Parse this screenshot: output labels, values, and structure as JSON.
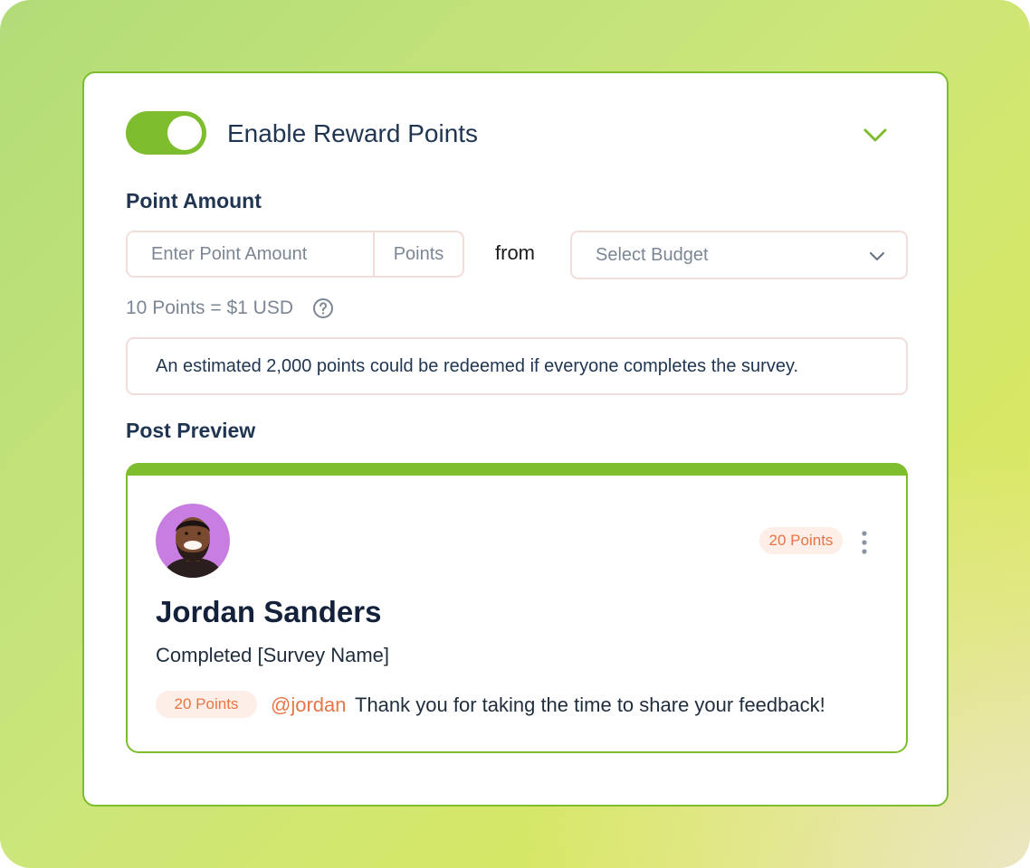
{
  "colors": {
    "accent": "#7dbd2e",
    "points_badge_bg": "#fdeee8",
    "points_badge_text": "#e87545",
    "heading": "#1f3551",
    "muted": "#7b8794",
    "border": "#f2ddd9"
  },
  "header": {
    "toggle_enabled": true,
    "title": "Enable Reward Points",
    "collapse_icon": "chevron-down-icon"
  },
  "point_amount": {
    "label": "Point Amount",
    "input_placeholder": "Enter Point Amount",
    "input_value": "",
    "unit": "Points",
    "from_text": "from",
    "budget_placeholder": "Select Budget",
    "budget_icon": "chevron-down-icon"
  },
  "rate": {
    "text": "10 Points = $1 USD",
    "icon": "question-circle-icon"
  },
  "estimate": {
    "text": "An estimated 2,000 points could be redeemed if everyone completes the survey."
  },
  "preview": {
    "label": "Post Preview",
    "points_badge": "20 Points",
    "menu_icon": "more-vertical-icon",
    "author": "Jordan Sanders",
    "title": "Completed [Survey Name]",
    "message_badge": "20 Points",
    "mention": "@jordan",
    "message": "Thank you for taking the time to share your feedback!"
  }
}
